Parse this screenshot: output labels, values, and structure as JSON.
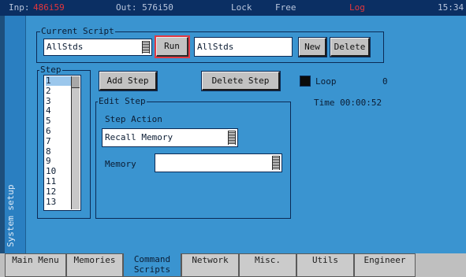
{
  "status_bar": {
    "input_label": "Inp:",
    "input_value": "486i59",
    "output": "Out: 576i50",
    "lock": "Lock",
    "free": "Free",
    "log": "Log",
    "time": "15:34"
  },
  "side_panel": {
    "label": "System setup"
  },
  "current_script": {
    "legend": "Current Script",
    "selected": "AllStds",
    "run_label": "Run",
    "name_value": "AllStds",
    "new_label": "New",
    "delete_label": "Delete"
  },
  "step_panel": {
    "legend": "Step",
    "steps": [
      "1",
      "2",
      "3",
      "4",
      "5",
      "6",
      "7",
      "8",
      "9",
      "10",
      "11",
      "12",
      "13"
    ],
    "selected_index": 0
  },
  "buttons": {
    "add_step": "Add Step",
    "delete_step": "Delete Step"
  },
  "loop": {
    "label": "Loop",
    "count": "0",
    "time": "Time 00:00:52",
    "checked": true
  },
  "edit_step": {
    "legend": "Edit Step",
    "action_label": "Step Action",
    "action_value": "Recall Memory",
    "memory_label": "Memory",
    "memory_value": ""
  },
  "tabs": [
    {
      "label": "Main Menu",
      "active": false
    },
    {
      "label": "Memories",
      "active": false
    },
    {
      "label": "Command Scripts",
      "active": true
    },
    {
      "label": "Network",
      "active": false
    },
    {
      "label": "Misc.",
      "active": false
    },
    {
      "label": "Utils",
      "active": false
    },
    {
      "label": "Engineer",
      "active": false
    }
  ],
  "colors": {
    "background": "#3a94d0",
    "status_bar": "#0b2f63",
    "alert_red": "#e3363c"
  }
}
